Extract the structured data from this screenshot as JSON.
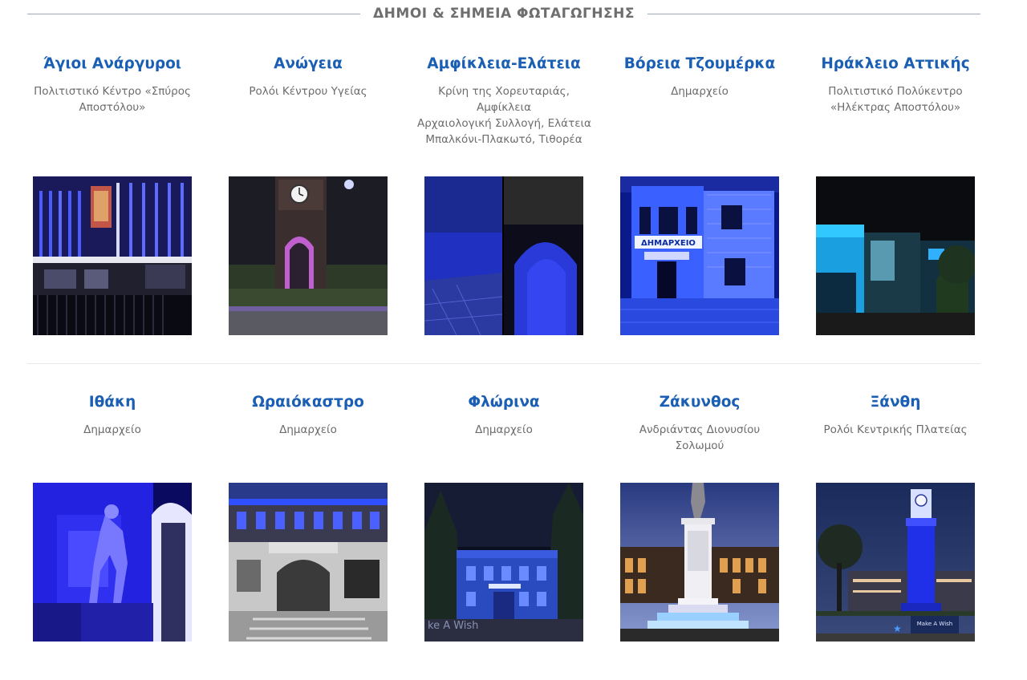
{
  "section": {
    "title": "ΔΗΜΟΙ & ΣΗΜΕΙΑ ΦΩΤΑΓΩΓΗΣΗΣ"
  },
  "row1": [
    {
      "name": "Άγιοι Ανάργυροι",
      "desc": [
        "Πολιτιστικό Κέντρο «Σπύρος",
        "Αποστόλου»"
      ]
    },
    {
      "name": "Ανώγεια",
      "desc": [
        "Ρολόι Κέντρου Υγείας"
      ]
    },
    {
      "name": "Αμφίκλεια-Ελάτεια",
      "desc": [
        "Κρίνη της Χορευταριάς,",
        "Αμφίκλεια",
        "Αρχαιολογική Συλλογή, Ελάτεια",
        "Μπαλκόνι-Πλακωτό, Τιθορέα"
      ]
    },
    {
      "name": "Βόρεια Τζουμέρκα",
      "desc": [
        "Δημαρχείο"
      ]
    },
    {
      "name": "Ηράκλειο Αττικής",
      "desc": [
        "Πολιτιστικό Πολύκεντρο",
        "«Ηλέκτρας Αποστόλου»"
      ]
    }
  ],
  "row2": [
    {
      "name": "Ιθάκη",
      "desc": [
        "Δημαρχείο"
      ]
    },
    {
      "name": "Ωραιόκαστρο",
      "desc": [
        "Δημαρχείο"
      ]
    },
    {
      "name": "Φλώρινα",
      "desc": [
        "Δημαρχείο"
      ]
    },
    {
      "name": "Ζάκυνθος",
      "desc": [
        "Ανδριάντας Διονυσίου",
        "Σολωμού"
      ]
    },
    {
      "name": "Ξάνθη",
      "desc": [
        "Ρολόι Κεντρικής Πλατείας"
      ]
    }
  ],
  "photo_text": {
    "bvoreia_sign": "ΔΗΜΑΡΧΕΙΟ",
    "florina_watermark": "ke A Wish",
    "xanthi_sign": "Make A Wish"
  },
  "colors": {
    "title_blue": "#1b5fb4",
    "desc_gray": "#6c6c6c",
    "section_gray": "#6e6e6e",
    "rule": "#9aa8c4"
  }
}
